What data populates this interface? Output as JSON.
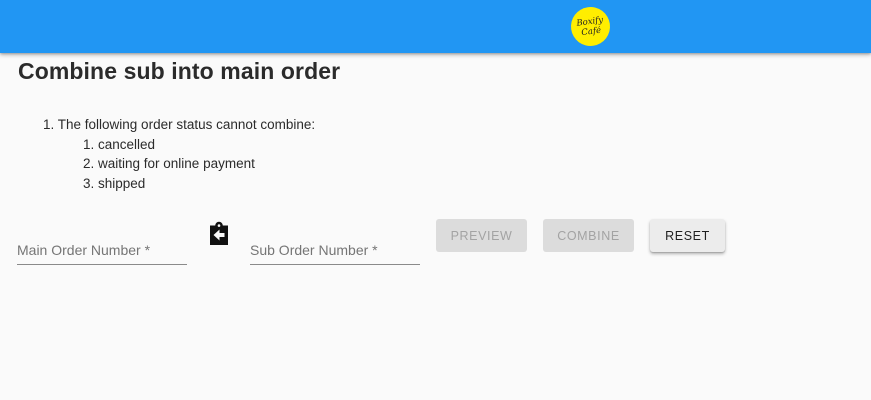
{
  "header": {
    "logo_line1": "Boxify",
    "logo_line2": "Café",
    "bar_color": "#2196f3",
    "logo_color": "#ffee00"
  },
  "page": {
    "title": "Combine sub into main order"
  },
  "rules": {
    "intro": "1. The following order status cannot combine:",
    "items": [
      "1. cancelled",
      "2. waiting for online payment",
      "3. shipped"
    ]
  },
  "form": {
    "main_order_placeholder": "Main Order Number *",
    "sub_order_placeholder": "Sub Order Number *",
    "main_order_value": "",
    "sub_order_value": "",
    "swap_icon": "clipboard-arrow-left-icon"
  },
  "actions": {
    "preview_label": "PREVIEW",
    "combine_label": "COMBINE",
    "reset_label": "RESET"
  }
}
